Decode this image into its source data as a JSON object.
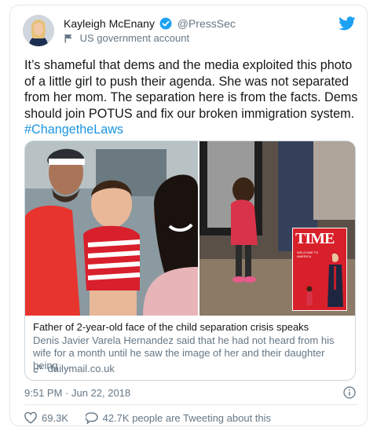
{
  "header": {
    "display_name": "Kayleigh McEnany",
    "handle": "@PressSec",
    "account_label": "US government account",
    "icons": {
      "verified": "verified-badge-icon",
      "flag": "flag-icon",
      "brand": "twitter-bird-icon",
      "avatar": "avatar"
    }
  },
  "tweet": {
    "text": "It’s shameful that dems and the media exploited this photo of a little girl to push their agenda. She was not separated from her mom. The separation here is from the facts. Dems should join POTUS and fix our broken immigration system.",
    "hashtag": "#ChangetheLaws"
  },
  "link_preview": {
    "title": "Father of 2-year-old face of the child separation crisis speaks",
    "description": "Denis Javier Varela Hernandez said that he had not heard from his wife for a month until he saw the image of her and their daughter being ...",
    "domain": "dailymail.co.uk",
    "magazine_logo": "TIME",
    "magazine_cover_line": "WELCOME TO AMERICA"
  },
  "meta": {
    "timestamp": "9:51 PM · Jun 22, 2018"
  },
  "stats": {
    "likes": "69.3K",
    "tweeting": "42.7K people are Tweeting about this"
  },
  "colors": {
    "brand_blue": "#1da1f2",
    "link_blue": "#1b95e0",
    "secondary_text": "#657786",
    "border": "#e1e8ed",
    "time_red": "#e51b24"
  }
}
